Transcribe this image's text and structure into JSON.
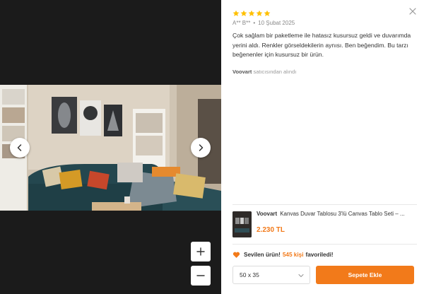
{
  "review": {
    "rating": 5,
    "rating_max": 5,
    "author": "A** B**",
    "date": "10 Şubat 2025",
    "text": "Çok sağlam bir paketleme ile hatasız kusursuz geldi ve duvarımda yerini aldı. Renkler görseldekilerin aynısı. Ben beğendim. Bu tarzı beğenenler için kusursuz bir ürün.",
    "seller_name": "Voovart",
    "seller_suffix": "satıcısından alındı"
  },
  "product": {
    "brand": "Voovart",
    "name": "Kanvas Duvar Tablosu 3'lü Canvas Tablo Seti – ...",
    "price": "2.230 TL"
  },
  "favorite": {
    "label": "Sevilen ürün!",
    "count": "545 kişi",
    "suffix": "favoriledi!"
  },
  "size_select": {
    "selected": "50 x 35"
  },
  "cart_button": "Sepete Ekle",
  "icons": {
    "star": "star-icon",
    "close": "close-icon",
    "prev": "chevron-left-icon",
    "next": "chevron-right-icon",
    "zoom_in": "plus-icon",
    "zoom_out": "minus-icon",
    "heart": "heart-icon",
    "dropdown": "chevron-down-icon"
  },
  "colors": {
    "accent": "#f27a1a",
    "star": "#ffc000",
    "viewer_bg": "#1b1b1b"
  }
}
